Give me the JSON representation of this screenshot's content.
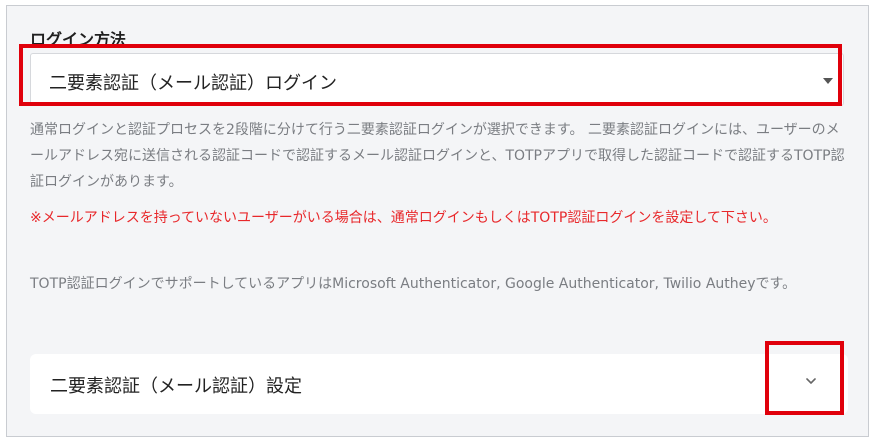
{
  "login_method": {
    "label": "ログイン方法",
    "selected": "二要素認証（メール認証）ログイン"
  },
  "descriptions": {
    "main": "通常ログインと認証プロセスを2段階に分けて行う二要素認証ログインが選択できます。 二要素認証ログインには、ユーザーのメールアドレス宛に送信される認証コードで認証するメール認証ログインと、TOTPアプリで取得した認証コードで認証するTOTP認証ログインがあります。",
    "warning": "※メールアドレスを持っていないユーザーがいる場合は、通常ログインもしくはTOTP認証ログインを設定して下さい。",
    "totp": "TOTP認証ログインでサポートしているアプリはMicrosoft Authenticator, Google Authenticator, Twilio Autheyです。"
  },
  "accordion": {
    "title": "二要素認証（メール認証）設定"
  },
  "colors": {
    "highlight": "#e0000b",
    "warning_text": "#e8282b",
    "muted_text": "#7a7d82",
    "panel_bg": "#f4f5f7"
  },
  "icons": {
    "select_caret": "caret-down-icon",
    "accordion_toggle": "chevron-down-icon"
  }
}
